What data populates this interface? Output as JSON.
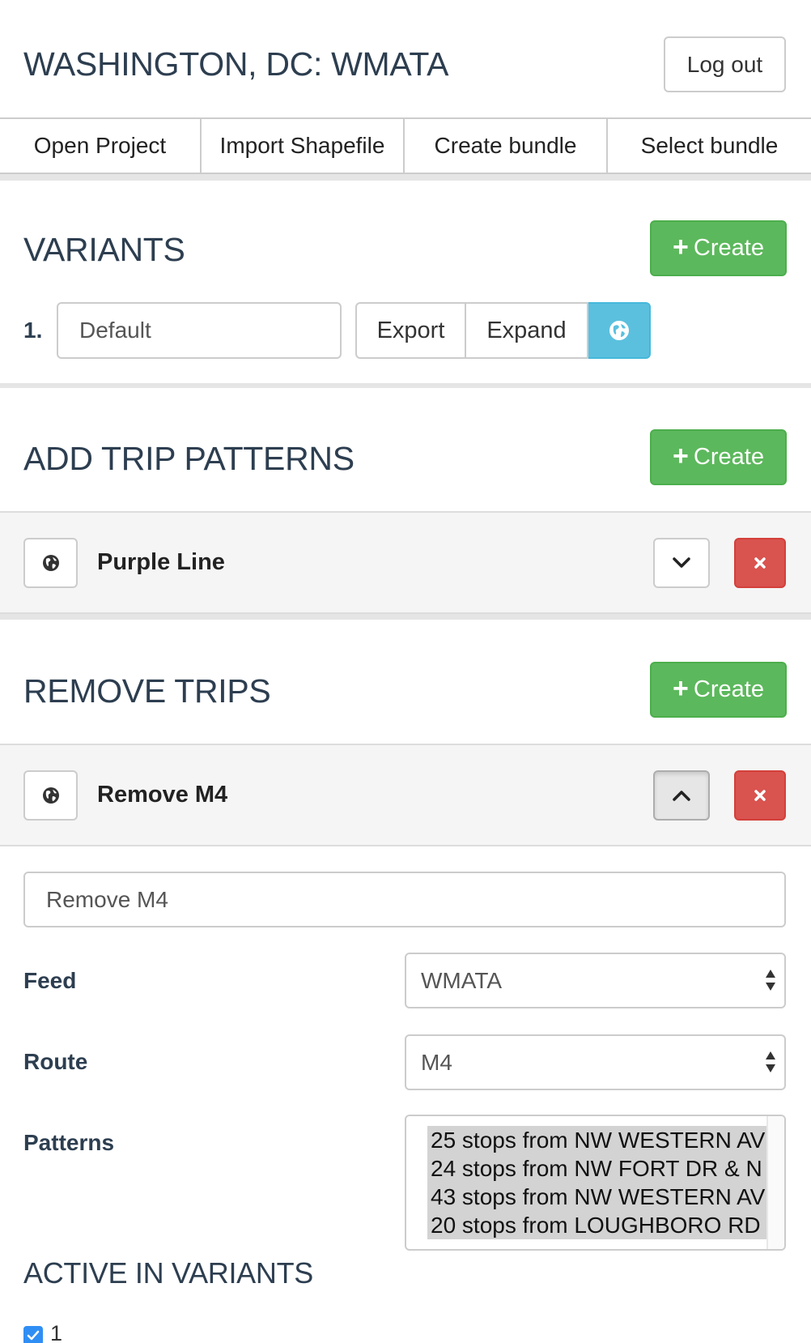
{
  "header": {
    "title": "WASHINGTON, DC: WMATA",
    "logout_label": "Log out"
  },
  "nav": {
    "tabs": [
      {
        "label": "Open Project"
      },
      {
        "label": "Import Shapefile"
      },
      {
        "label": "Create bundle"
      },
      {
        "label": "Select bundle"
      }
    ]
  },
  "variants": {
    "title": "VARIANTS",
    "create_label": "Create",
    "items": [
      {
        "number": "1.",
        "name": "Default",
        "export_label": "Export",
        "expand_label": "Expand",
        "icon": "globe-icon"
      }
    ]
  },
  "add_trip_patterns": {
    "title": "ADD TRIP PATTERNS",
    "create_label": "Create",
    "items": [
      {
        "label": "Purple Line",
        "expanded": false
      }
    ]
  },
  "remove_trips": {
    "title": "REMOVE TRIPS",
    "create_label": "Create",
    "items": [
      {
        "label": "Remove M4",
        "expanded": true
      }
    ]
  },
  "remove_form": {
    "name_value": "Remove M4",
    "feed_label": "Feed",
    "feed_value": "WMATA",
    "route_label": "Route",
    "route_value": "M4",
    "patterns_label": "Patterns",
    "patterns": [
      "25 stops from NW WESTERN AV",
      "24 stops from NW FORT DR & N",
      "43 stops from NW WESTERN AV",
      "20 stops from LOUGHBORO RD"
    ],
    "active_title": "ACTIVE IN VARIANTS",
    "active_variants": [
      {
        "label": "1",
        "checked": true
      }
    ]
  },
  "colors": {
    "success": "#5cb85c",
    "danger": "#d9534f",
    "info": "#5bc0de",
    "heading": "#2d3e50"
  }
}
